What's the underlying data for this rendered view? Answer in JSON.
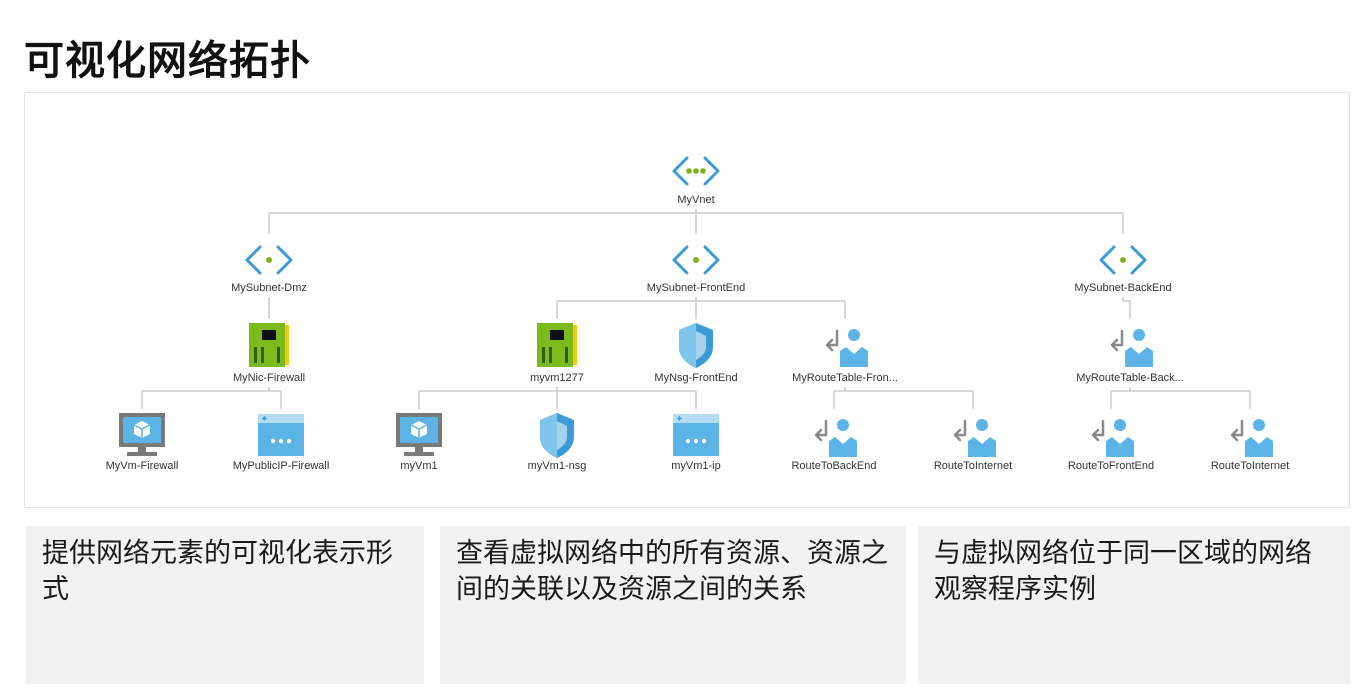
{
  "page": {
    "title": "可视化网络拓扑"
  },
  "topology": {
    "nodes": [
      {
        "id": "vnet",
        "label": "MyVnet",
        "icon": "vnet-icon"
      },
      {
        "id": "sn_dmz",
        "label": "MySubnet-Dmz",
        "icon": "subnet-icon"
      },
      {
        "id": "sn_front",
        "label": "MySubnet-FrontEnd",
        "icon": "subnet-icon"
      },
      {
        "id": "sn_back",
        "label": "MySubnet-BackEnd",
        "icon": "subnet-icon"
      },
      {
        "id": "nic_fw",
        "label": "MyNic-Firewall",
        "icon": "network-interface-icon"
      },
      {
        "id": "vm1277",
        "label": "myvm1277",
        "icon": "network-interface-icon"
      },
      {
        "id": "nsg_front",
        "label": "MyNsg-FrontEnd",
        "icon": "nsg-shield-icon"
      },
      {
        "id": "rt_front",
        "label": "MyRouteTable-Fron...",
        "icon": "route-table-icon"
      },
      {
        "id": "rt_back",
        "label": "MyRouteTable-Back...",
        "icon": "route-table-icon"
      },
      {
        "id": "vm_fw",
        "label": "MyVm-Firewall",
        "icon": "virtual-machine-icon"
      },
      {
        "id": "pip_fw",
        "label": "MyPublicIP-Firewall",
        "icon": "public-ip-icon"
      },
      {
        "id": "myvm1",
        "label": "myVm1",
        "icon": "virtual-machine-icon"
      },
      {
        "id": "myvm1_nsg",
        "label": "myVm1-nsg",
        "icon": "nsg-shield-icon"
      },
      {
        "id": "myvm1_ip",
        "label": "myVm1-ip",
        "icon": "public-ip-icon"
      },
      {
        "id": "r_tobackend",
        "label": "RouteToBackEnd",
        "icon": "route-icon"
      },
      {
        "id": "r_tointernet1",
        "label": "RouteToInternet",
        "icon": "route-icon"
      },
      {
        "id": "r_tofrontend",
        "label": "RouteToFrontEnd",
        "icon": "route-icon"
      },
      {
        "id": "r_tointernet2",
        "label": "RouteToInternet",
        "icon": "route-icon"
      }
    ],
    "edges": [
      [
        "vnet",
        "sn_dmz"
      ],
      [
        "vnet",
        "sn_front"
      ],
      [
        "vnet",
        "sn_back"
      ],
      [
        "sn_dmz",
        "nic_fw"
      ],
      [
        "sn_front",
        "vm1277"
      ],
      [
        "sn_front",
        "nsg_front"
      ],
      [
        "sn_front",
        "rt_front"
      ],
      [
        "sn_back",
        "rt_back"
      ],
      [
        "nic_fw",
        "vm_fw"
      ],
      [
        "nic_fw",
        "pip_fw"
      ],
      [
        "vm1277",
        "myvm1"
      ],
      [
        "vm1277",
        "myvm1_nsg"
      ],
      [
        "vm1277",
        "myvm1_ip"
      ],
      [
        "rt_front",
        "r_tobackend"
      ],
      [
        "rt_front",
        "r_tointernet1"
      ],
      [
        "rt_back",
        "r_tofrontend"
      ],
      [
        "rt_back",
        "r_tointernet2"
      ]
    ]
  },
  "cards": [
    {
      "text": "提供网络元素的可视化表示形式"
    },
    {
      "text": "查看虚拟网络中的所有资源、资源之间的关联以及资源之间的关系"
    },
    {
      "text": "与虚拟网络位于同一区域的网络观察程序实例"
    }
  ],
  "colors": {
    "azure_blue": "#3b9bd6",
    "light_blue": "#5bb4e5",
    "green_dot": "#7ab317",
    "nic_green": "#7cbb1c",
    "nic_yellow": "#f2c811",
    "gray_arrow": "#8a8a8a",
    "connector": "#c4c4c4"
  }
}
